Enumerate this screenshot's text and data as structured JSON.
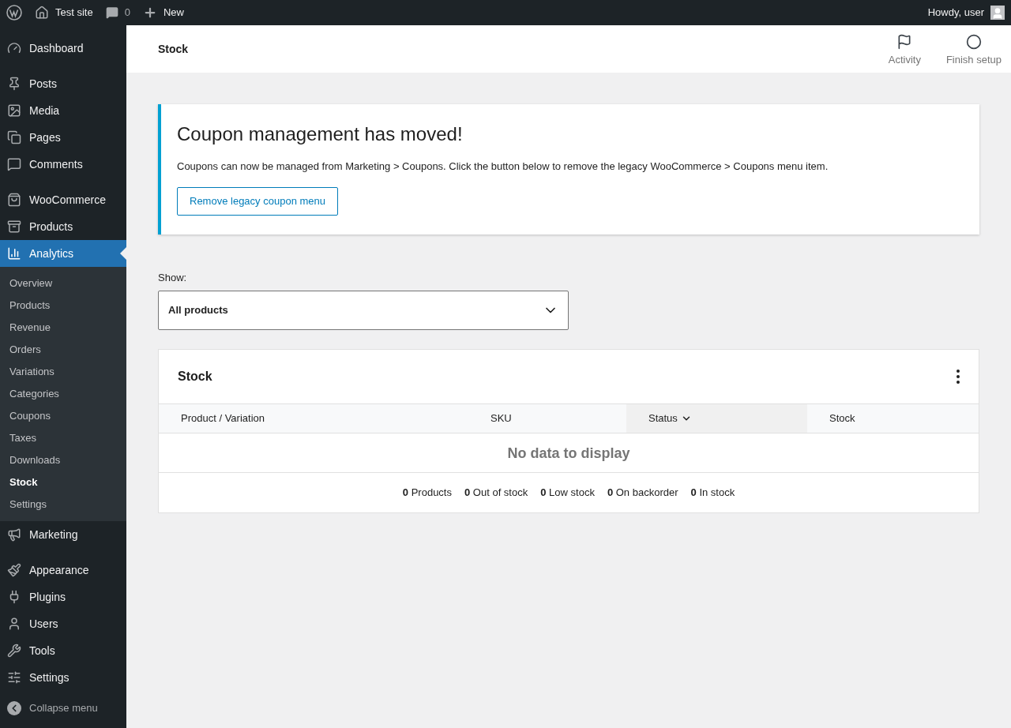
{
  "admin_bar": {
    "site_name": "Test site",
    "comments_count": "0",
    "new_label": "New",
    "greeting": "Howdy, user"
  },
  "sidebar": {
    "sections": [
      [
        {
          "label": "Dashboard",
          "selected": false
        }
      ],
      [
        {
          "label": "Posts",
          "selected": false
        },
        {
          "label": "Media",
          "selected": false
        },
        {
          "label": "Pages",
          "selected": false
        },
        {
          "label": "Comments",
          "selected": false
        }
      ],
      [
        {
          "label": "WooCommerce",
          "selected": false
        },
        {
          "label": "Products",
          "selected": false
        },
        {
          "label": "Analytics",
          "selected": true,
          "children": [
            {
              "label": "Overview",
              "selected": false
            },
            {
              "label": "Products",
              "selected": false
            },
            {
              "label": "Revenue",
              "selected": false
            },
            {
              "label": "Orders",
              "selected": false
            },
            {
              "label": "Variations",
              "selected": false
            },
            {
              "label": "Categories",
              "selected": false
            },
            {
              "label": "Coupons",
              "selected": false
            },
            {
              "label": "Taxes",
              "selected": false
            },
            {
              "label": "Downloads",
              "selected": false
            },
            {
              "label": "Stock",
              "selected": true
            },
            {
              "label": "Settings",
              "selected": false
            }
          ]
        },
        {
          "label": "Marketing",
          "selected": false
        }
      ],
      [
        {
          "label": "Appearance",
          "selected": false
        },
        {
          "label": "Plugins",
          "selected": false
        },
        {
          "label": "Users",
          "selected": false
        },
        {
          "label": "Tools",
          "selected": false
        },
        {
          "label": "Settings",
          "selected": false
        }
      ]
    ],
    "collapse_label": "Collapse menu"
  },
  "header": {
    "title": "Stock",
    "actions": [
      {
        "label": "Activity"
      },
      {
        "label": "Finish setup"
      }
    ]
  },
  "notice": {
    "title": "Coupon management has moved!",
    "text": "Coupons can now be managed from Marketing > Coupons. Click the button below to remove the legacy WooCommerce > Coupons menu item.",
    "button": "Remove legacy coupon menu"
  },
  "filter": {
    "label": "Show:",
    "value": "All products"
  },
  "stock_card": {
    "title": "Stock",
    "columns": [
      {
        "label": "Product / Variation",
        "sorted": false
      },
      {
        "label": "SKU",
        "sorted": false
      },
      {
        "label": "Status",
        "sorted": true
      },
      {
        "label": "Stock",
        "sorted": false
      }
    ],
    "empty_message": "No data to display",
    "summary": [
      {
        "count": "0",
        "label": "Products"
      },
      {
        "count": "0",
        "label": "Out of stock"
      },
      {
        "count": "0",
        "label": "Low stock"
      },
      {
        "count": "0",
        "label": "On backorder"
      },
      {
        "count": "0",
        "label": "In stock"
      }
    ]
  }
}
